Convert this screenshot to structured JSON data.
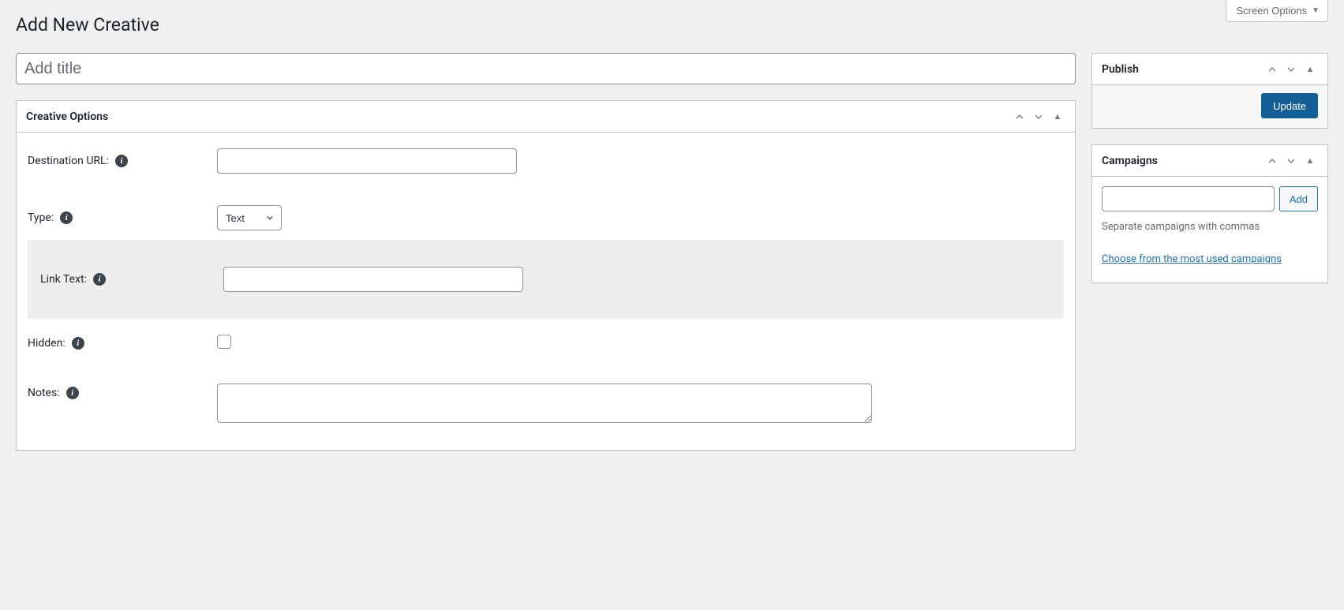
{
  "screenOptions": {
    "label": "Screen Options"
  },
  "pageTitle": "Add New Creative",
  "titleInput": {
    "placeholder": "Add title",
    "value": ""
  },
  "creativeOptions": {
    "heading": "Creative Options",
    "fields": {
      "destinationUrl": {
        "label": "Destination URL:",
        "value": ""
      },
      "type": {
        "label": "Type:",
        "options": [
          "Text"
        ],
        "selected": "Text"
      },
      "linkText": {
        "label": "Link Text:",
        "value": ""
      },
      "hidden": {
        "label": "Hidden:",
        "checked": false
      },
      "notes": {
        "label": "Notes:",
        "value": ""
      }
    }
  },
  "publish": {
    "heading": "Publish",
    "updateLabel": "Update"
  },
  "campaigns": {
    "heading": "Campaigns",
    "addLabel": "Add",
    "inputValue": "",
    "hint": "Separate campaigns with commas",
    "mostUsedLink": "Choose from the most used campaigns"
  }
}
